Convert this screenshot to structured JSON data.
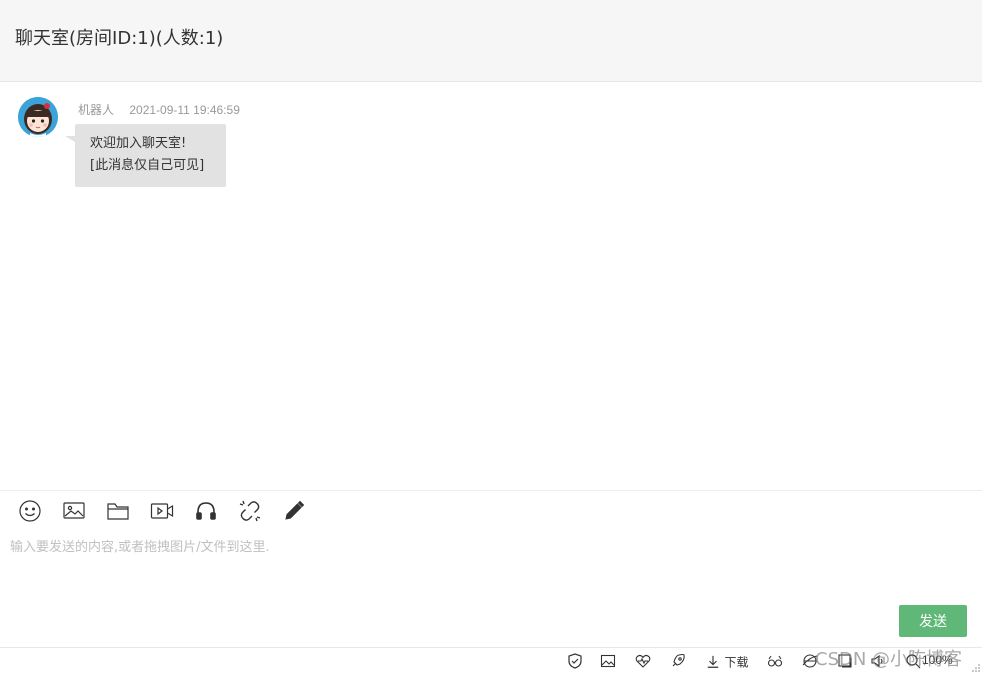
{
  "header": {
    "title": "聊天室(房间ID:1)(人数:1)"
  },
  "messages": [
    {
      "sender": "机器人",
      "time": "2021-09-11 19:46:59",
      "lines": [
        "欢迎加入聊天室!",
        "[此消息仅自己可见]"
      ]
    }
  ],
  "toolbar": {
    "icons": [
      "emoji-icon",
      "image-icon",
      "folder-icon",
      "video-icon",
      "audio-icon",
      "link-icon",
      "pen-icon"
    ]
  },
  "input": {
    "placeholder": "输入要发送的内容,或者拖拽图片/文件到这里."
  },
  "send_button": {
    "label": "发送"
  },
  "colors": {
    "send_button": "#5fb878",
    "header_bg": "#f6f6f6",
    "bubble_bg": "#e2e2e2",
    "avatar_bg": "#3aa3d8"
  },
  "statusbar": {
    "download_label": "下载",
    "zoom": "100%"
  },
  "watermark": "CSDN @小陈博客"
}
